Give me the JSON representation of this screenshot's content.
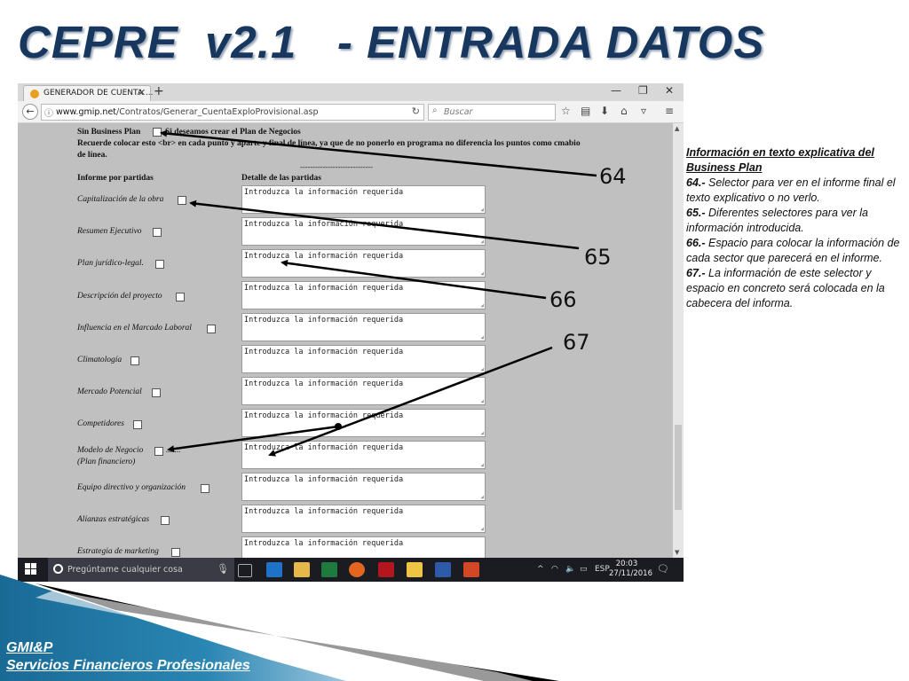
{
  "slide": {
    "title": "CEPRE  v2.1   - ENTRADA DATOS",
    "footer_line1": "GMI&P",
    "footer_line2": "Servicios Financieros Profesionales",
    "colors": {
      "title": "#17375e",
      "footer_band": "#1f6e99",
      "footer_accent": "#000000"
    }
  },
  "browser": {
    "tab_title": "GENERADOR DE CUENTA ...",
    "tab_close": "✕",
    "new_tab": "+",
    "url_host": "www.gmip.net",
    "url_path": "/Contratos/Generar_CuentaExploProvisional.asp",
    "search_placeholder": "Buscar",
    "controls": {
      "minimize": "—",
      "maximize": "❐",
      "close": "✕"
    },
    "icons": [
      "back-icon",
      "info-icon",
      "reload-icon",
      "search-icon",
      "bookmark-star-icon",
      "reading-list-icon",
      "download-icon",
      "home-icon",
      "pocket-icon",
      "menu-icon"
    ]
  },
  "page": {
    "sbp_label": "Sin Business Plan",
    "sbp_rest": "Si deseamos crear el Plan de Negocios",
    "note_line1": "Recuerde colocar esto <br> en cada punto y aparte y final de línea, ya que de no ponerlo en programa no diferencia los puntos como cmabio",
    "note_line2": "de línea.",
    "divider": "-----------------------------",
    "col_left": "Informe por partidas",
    "col_right": "Detalle de las partidas",
    "placeholder": "Introduzca la información requerida",
    "rows": [
      {
        "label": "Capitalización de la obra"
      },
      {
        "label": "Resumen Ejecutivo"
      },
      {
        "label": "Plan jurídico-legal."
      },
      {
        "label": "Descripción del proyecto"
      },
      {
        "label": "Influencia en el Marcado Laboral"
      },
      {
        "label": "Climatología"
      },
      {
        "label": "Mercado Potencial"
      },
      {
        "label": "Competidores"
      },
      {
        "label": "Modelo de Negocio",
        "suffix": ".......",
        "label2": "(Plan financiero)"
      },
      {
        "label": "Equipo directivo y organización"
      },
      {
        "label": "Alianzas estratégicas"
      },
      {
        "label": "Estrategia de marketing"
      }
    ]
  },
  "taskbar": {
    "search_text": "Pregúntame cualquier cosa",
    "lang": "ESP",
    "time": "20:03",
    "date": "27/11/2016"
  },
  "callouts": [
    "64",
    "65",
    "66",
    "67"
  ],
  "info": {
    "heading": "Información en texto explicativa del Business Plan",
    "items": [
      {
        "num": "64.-",
        "text": " Selector para ver en el informe final el texto explicativo o no verlo."
      },
      {
        "num": "65.-",
        "text": " Diferentes selectores para ver la información introducida."
      },
      {
        "num": "66.-",
        "text": " Espacio para colocar la información de cada sector que parecerá en el informe."
      },
      {
        "num": "67.-",
        "text": " La información de este selector y espacio en concreto será colocada en la cabecera del informa."
      }
    ]
  }
}
